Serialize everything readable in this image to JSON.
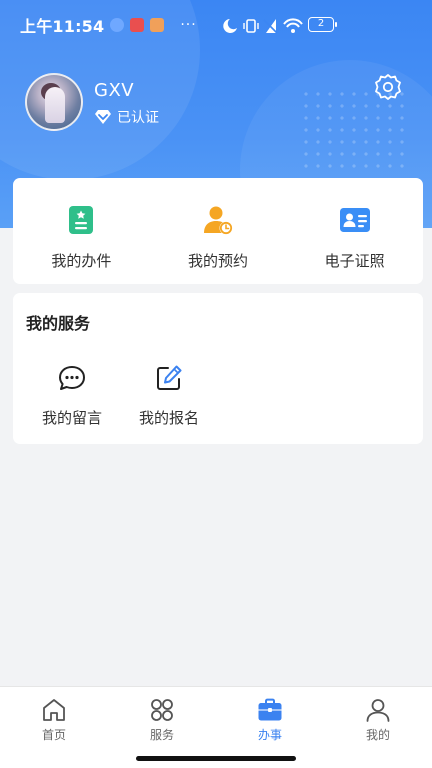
{
  "status_bar": {
    "time": "上午11:54",
    "battery": "2"
  },
  "profile": {
    "username": "GXV",
    "verify_label": "已认证"
  },
  "quick_actions": [
    {
      "label": "我的办件",
      "icon": "task-icon"
    },
    {
      "label": "我的预约",
      "icon": "appointment-icon"
    },
    {
      "label": "电子证照",
      "icon": "id-card-icon"
    }
  ],
  "services": {
    "title": "我的服务",
    "items": [
      {
        "label": "我的留言",
        "icon": "message-icon"
      },
      {
        "label": "我的报名",
        "icon": "edit-icon"
      }
    ]
  },
  "tabs": [
    {
      "label": "首页",
      "icon": "home-icon",
      "active": false
    },
    {
      "label": "服务",
      "icon": "grid-icon",
      "active": false
    },
    {
      "label": "办事",
      "icon": "briefcase-icon",
      "active": true
    },
    {
      "label": "我的",
      "icon": "user-icon",
      "active": false
    }
  ],
  "colors": {
    "header_blue": "#3b86f3",
    "active_blue": "#3b82f0",
    "task_green": "#2fbf8a",
    "appointment_orange": "#f5a623",
    "idcard_blue": "#3a8ef6"
  }
}
